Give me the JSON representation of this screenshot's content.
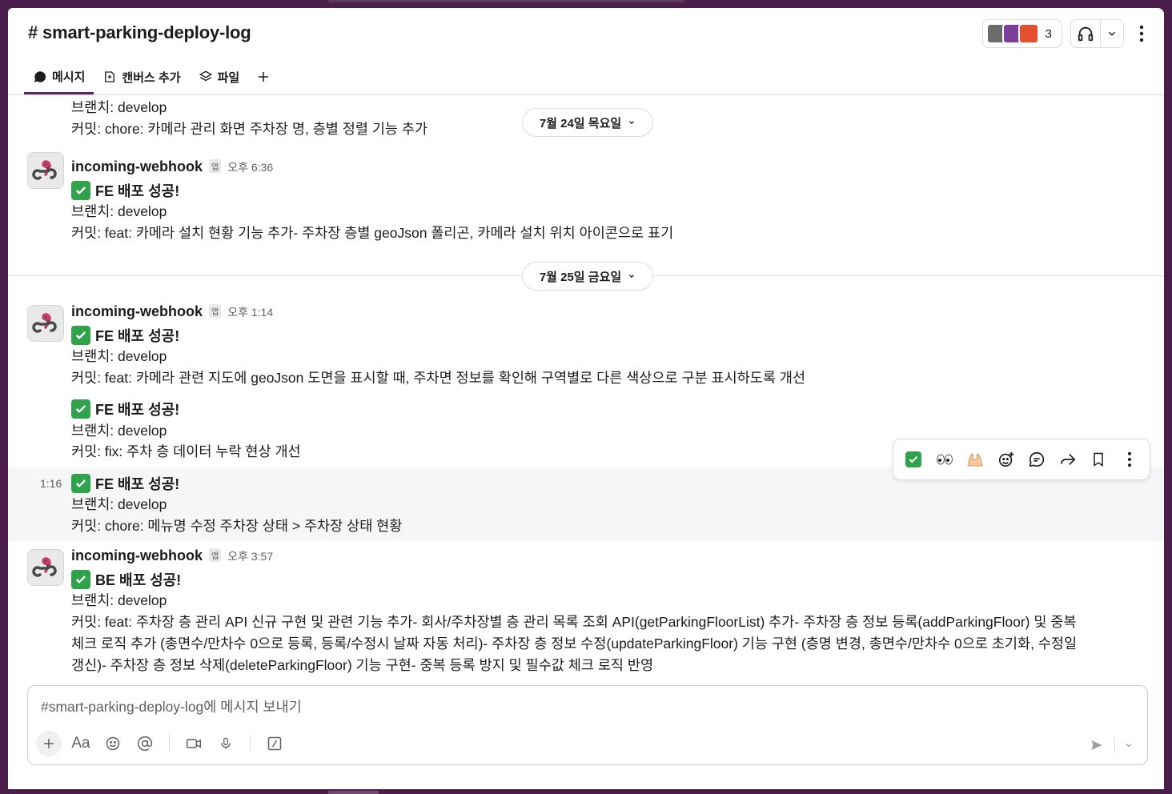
{
  "channel": {
    "title": "smart-parking-deploy-log",
    "hash": "#",
    "members_count": "3"
  },
  "tabs": [
    {
      "label": "메시지",
      "icon": "message-icon"
    },
    {
      "label": "캔버스 추가",
      "icon": "canvas-icon"
    },
    {
      "label": "파일",
      "icon": "files-icon"
    }
  ],
  "dates": {
    "d1": "7월 24일 목요일",
    "d2": "7월 25일 금요일"
  },
  "prev": {
    "branch": "브랜치: develop",
    "commit": "커밋: chore: 카메라 관리 화면 주차장 명, 층별 정렬 기능 추가"
  },
  "msg1": {
    "sender": "incoming-webhook",
    "badge": "앱",
    "time": "오후 6:36",
    "title": "FE 배포 성공!",
    "branch": "브랜치: develop",
    "commit": "커밋: feat: 카메라 설치 현황 기능 추가- 주차장 층별 geoJson 폴리곤, 카메라 설치 위치 아이콘으로 표기"
  },
  "msg2": {
    "sender": "incoming-webhook",
    "badge": "앱",
    "time": "오후 1:14",
    "title": "FE 배포 성공!",
    "branch": "브랜치: develop",
    "commit": "커밋: feat: 카메라 관련 지도에 geoJson 도면을 표시할 때, 주차면 정보를 확인해 구역별로 다른 색상으로 구분 표시하도록 개선"
  },
  "msg3": {
    "title": "FE 배포 성공!",
    "branch": "브랜치: develop",
    "commit": "커밋: fix: 주차 층 데이터 누락 현상 개선"
  },
  "msg4": {
    "side_time": "1:16",
    "title": "FE 배포 성공!",
    "branch": "브랜치: develop",
    "commit": "커밋: chore: 메뉴명 수정 주차장 상태 > 주차장 상태 현황"
  },
  "msg5": {
    "sender": "incoming-webhook",
    "badge": "앱",
    "time": "오후 3:57",
    "title": "BE 배포 성공!",
    "branch": "브랜치: develop",
    "commit_l1": "커밋: feat: 주차장 층 관리 API 신규 구현 및 관련 기능 추가- 회사/주차장별 층 관리 목록 조회 API(getParkingFloorList) 추가- 주차장 층 정보 등록(addParkingFloor) 및 중복",
    "commit_l2": "체크 로직 추가 (총면수/만차수 0으로 등록, 등록/수정시 날짜 자동 처리)- 주차장 층 정보 수정(updateParkingFloor) 기능 구현 (층명 변경, 총면수/만차수 0으로 초기화, 수정일",
    "commit_l3": "갱신)- 주차장 층 정보 삭제(deleteParkingFloor) 기능 구현- 중복 등록 방지 및 필수값 체크 로직 반영"
  },
  "composer": {
    "placeholder": "#smart-parking-deploy-log에 메시지 보내기",
    "format_label": "Aa"
  },
  "colors": {
    "aubergine": "#4a1d4b",
    "tab_underline": "#611f69",
    "check_green": "#31a24c"
  }
}
